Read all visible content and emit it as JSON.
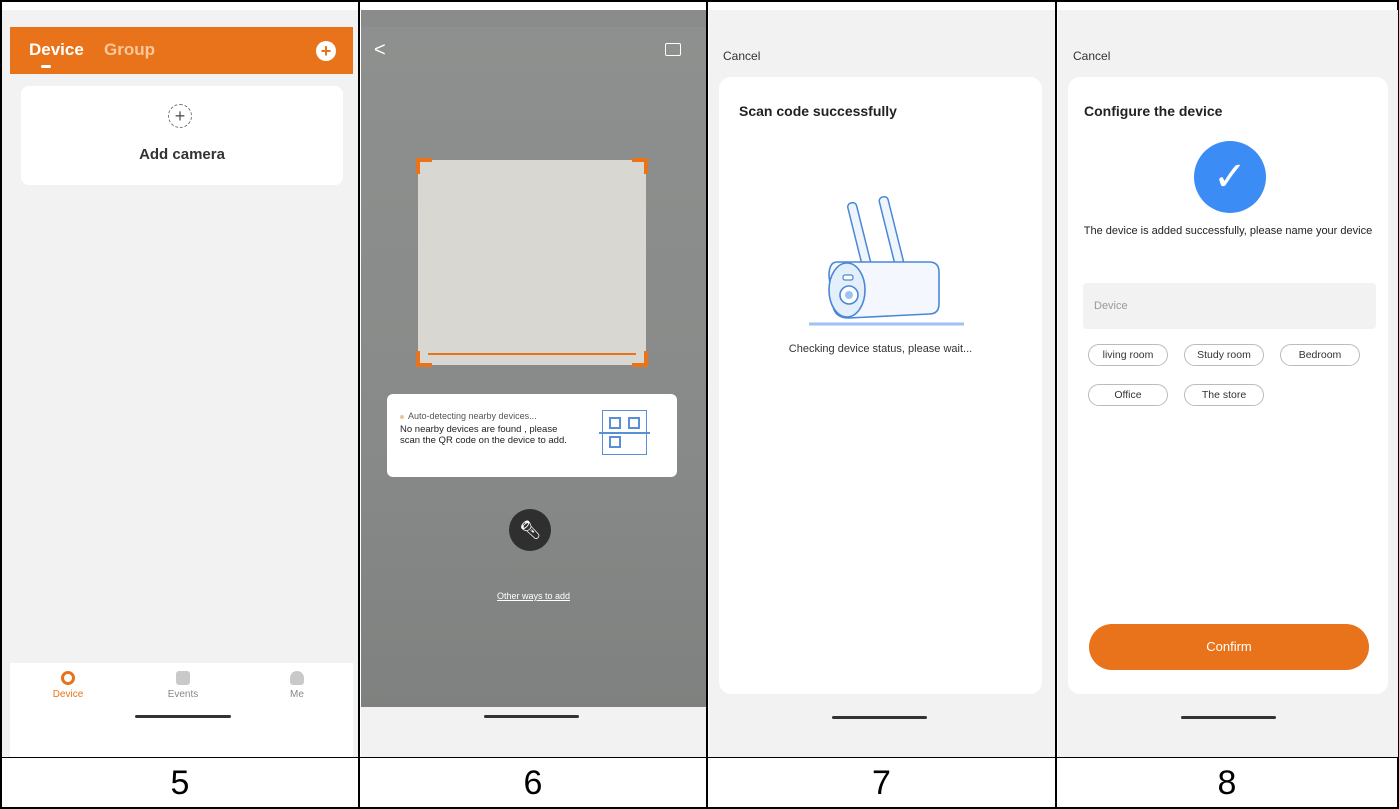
{
  "panel_numbers": [
    "5",
    "6",
    "7",
    "8"
  ],
  "screen5": {
    "tabs": {
      "device": "Device",
      "group": "Group"
    },
    "add_symbol": "+",
    "add_camera": {
      "icon_symbol": "+",
      "label": "Add camera"
    },
    "bottom_nav": [
      {
        "label": "Device",
        "icon": "camera-icon",
        "active": true
      },
      {
        "label": "Events",
        "icon": "chat-icon",
        "active": false
      },
      {
        "label": "Me",
        "icon": "user-icon",
        "active": false
      }
    ]
  },
  "screen6": {
    "back_symbol": "<",
    "gallery_icon": "gallery-icon",
    "auto_detecting": "Auto-detecting nearby devices...",
    "message": "No nearby devices are found , please scan the QR code on the device to add.",
    "torch_icon": "flashlight-icon",
    "other_ways": "Other ways to add"
  },
  "screen7": {
    "cancel": "Cancel",
    "title": "Scan code successfully",
    "illustration_icon": "camera-illustration-icon",
    "status": "Checking device status, please wait..."
  },
  "screen8": {
    "cancel": "Cancel",
    "title": "Configure the device",
    "check_symbol": "✓",
    "success_message": "The device is added successfully, please name your device",
    "name_placeholder": "Device",
    "room_chips": [
      "living room",
      "Study room",
      "Bedroom",
      "Office",
      "The store"
    ],
    "confirm": "Confirm"
  },
  "colors": {
    "accent": "#e8731a",
    "check_blue": "#3b8cf5",
    "background": "#f2f2f2"
  }
}
